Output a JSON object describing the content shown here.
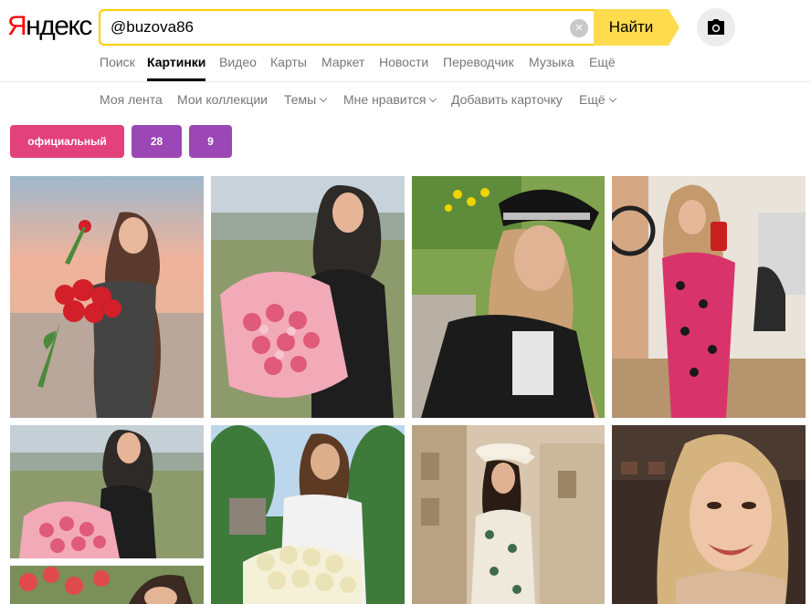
{
  "logo": {
    "first": "Я",
    "rest": "ндекс"
  },
  "search": {
    "value": "@buzova86",
    "clear": "×",
    "submit_label": "Найти"
  },
  "tabs": [
    "Поиск",
    "Картинки",
    "Видео",
    "Карты",
    "Маркет",
    "Новости",
    "Переводчик",
    "Музыка",
    "Ещё"
  ],
  "active_tab": "Картинки",
  "subnav": {
    "my_feed": "Моя лента",
    "my_collections": "Мои коллекции",
    "themes": "Темы",
    "i_like": "Мне нравится",
    "add_card": "Добавить карточку",
    "more": "Ещё"
  },
  "chips": [
    {
      "label": "официальный",
      "color": "#e3417a"
    },
    {
      "label": "28",
      "color": "#9b47b5"
    },
    {
      "label": "9",
      "color": "#9b47b5"
    }
  ],
  "colors": {
    "brand_red": "#ff0000",
    "search_yellow": "#ffdb4d",
    "search_border": "#ffcc00"
  },
  "images": [
    {
      "name": "image-woman-red-roses-sunset"
    },
    {
      "name": "image-woman-pink-bouquet"
    },
    {
      "name": "image-woman-black-cap-selfie"
    },
    {
      "name": "image-woman-floral-dress-selfie"
    },
    {
      "name": "image-woman-bouquet-small"
    },
    {
      "name": "image-woman-white-roses"
    },
    {
      "name": "image-woman-white-hat-street"
    },
    {
      "name": "image-woman-portrait-smile"
    },
    {
      "name": "image-woman-flowers-partial"
    }
  ]
}
